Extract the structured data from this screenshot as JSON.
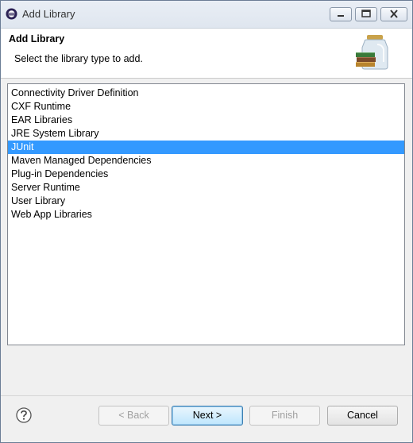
{
  "window": {
    "title": "Add Library",
    "icon": "eclipse-icon",
    "controls": [
      "minimize-icon",
      "maximize-icon",
      "close-icon"
    ]
  },
  "header": {
    "title": "Add Library",
    "description": "Select the library type to add.",
    "icon": "library-jar-icon"
  },
  "library_types": {
    "selected": "JUnit",
    "items": [
      {
        "label": "Connectivity Driver Definition"
      },
      {
        "label": "CXF Runtime"
      },
      {
        "label": "EAR Libraries"
      },
      {
        "label": "JRE System Library"
      },
      {
        "label": "JUnit"
      },
      {
        "label": "Maven Managed Dependencies"
      },
      {
        "label": "Plug-in Dependencies"
      },
      {
        "label": "Server Runtime"
      },
      {
        "label": "User Library"
      },
      {
        "label": "Web App Libraries"
      }
    ]
  },
  "footer": {
    "help_icon": "help-icon",
    "back_label": "< Back",
    "next_label": "Next >",
    "finish_label": "Finish",
    "cancel_label": "Cancel"
  },
  "colors": {
    "selection": "#3399ff",
    "title_bar": "#dfe6ef",
    "dialog_bg": "#f0f0f0"
  }
}
